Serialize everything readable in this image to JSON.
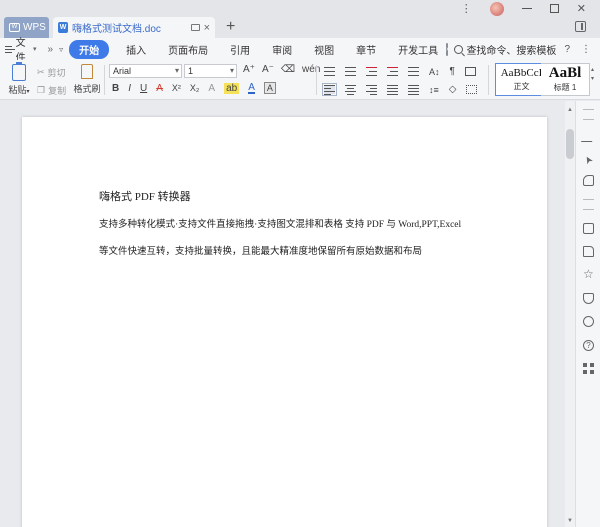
{
  "titlebar": {
    "wps_tab": "WPS",
    "doc_tab": "嗨格式测试文档.doc",
    "new_tab": "+"
  },
  "menubar": {
    "file": "文件",
    "more_left": "»",
    "items": [
      "开始",
      "插入",
      "页面布局",
      "引用",
      "审阅",
      "视图",
      "章节",
      "开发工具"
    ],
    "search": "查找命令、搜索模板",
    "help": "?",
    "more": "⋮",
    "collapse": "⌃"
  },
  "ribbon": {
    "paste": "粘贴",
    "cut": "剪切",
    "copy": "复制",
    "format_painter": "格式刷",
    "font_name": "Arial",
    "font_size": "1",
    "bold": "B",
    "italic": "I",
    "underline": "U",
    "strike": "A",
    "superscript": "X²",
    "subscript": "X₂",
    "grow": "A⁺",
    "shrink": "A⁻",
    "font_color": "A",
    "char_shading": "A",
    "styles": [
      {
        "sample": "AaBbCcI",
        "name": "正文"
      },
      {
        "sample": "AaBl",
        "name": "标题 1"
      }
    ]
  },
  "document": {
    "lines": [
      "嗨格式 PDF 转换器",
      "支持多种转化模式·支持文件直接拖拽·支持图文混排和表格  支持 PDF 与 Word,PPT,Excel",
      "等文件快速互转，支持批量转换，且能最大精准度地保留所有原始数据和布局"
    ]
  }
}
